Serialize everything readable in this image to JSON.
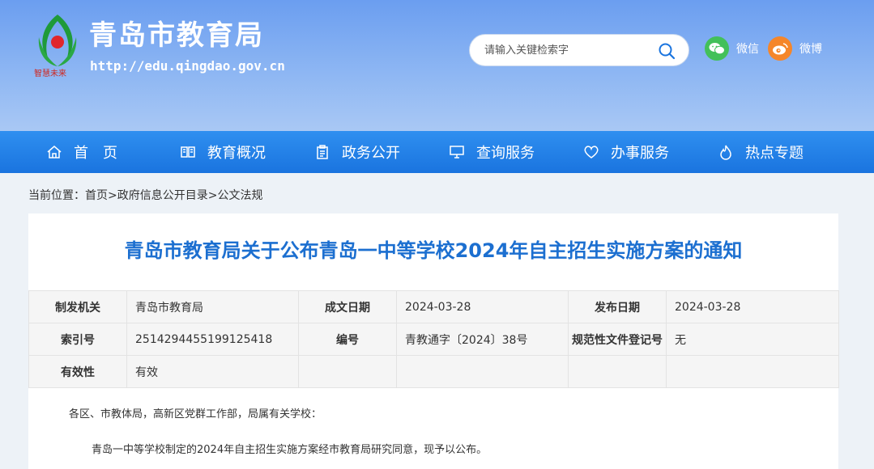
{
  "header": {
    "site_name": "青岛市教育局",
    "site_url": "http://edu.qingdao.gov.cn",
    "logo_icon": "green-red-emblem-icon",
    "search_placeholder": "请输入关键检索字",
    "social": [
      {
        "label": "微信",
        "icon": "wechat-icon",
        "color": "#43c05a"
      },
      {
        "label": "微博",
        "icon": "weibo-icon",
        "color": "#f5862a"
      }
    ]
  },
  "nav": {
    "items": [
      {
        "label": "首　页",
        "icon": "home-icon"
      },
      {
        "label": "教育概况",
        "icon": "book-icon"
      },
      {
        "label": "政务公开",
        "icon": "clipboard-icon"
      },
      {
        "label": "查询服务",
        "icon": "monitor-icon"
      },
      {
        "label": "办事服务",
        "icon": "heart-icon"
      },
      {
        "label": "热点专题",
        "icon": "flame-icon"
      }
    ]
  },
  "breadcrumb": {
    "prefix": "当前位置：",
    "items": [
      "首页",
      "政府信息公开目录",
      "公文法规"
    ],
    "separator": ">"
  },
  "article": {
    "title": "青岛市教育局关于公布青岛一中等学校2024年自主招生实施方案的通知",
    "meta": [
      [
        {
          "key": "制发机关",
          "value": "青岛市教育局"
        },
        {
          "key": "成文日期",
          "value": "2024-03-28"
        },
        {
          "key": "发布日期",
          "value": "2024-03-28"
        }
      ],
      [
        {
          "key": "索引号",
          "value": "2514294455199125418"
        },
        {
          "key": "编号",
          "value": "青教通字〔2024〕38号"
        },
        {
          "key": "规范性文件登记号",
          "value": "无"
        }
      ],
      [
        {
          "key": "有效性",
          "value": "有效"
        },
        {
          "key": "",
          "value": ""
        },
        {
          "key": "",
          "value": ""
        }
      ]
    ],
    "paragraphs": [
      "各区、市教体局，高新区党群工作部，局属有关学校：",
      "青岛一中等学校制定的2024年自主招生实施方案经市教育局研究同意，现予以公布。"
    ]
  },
  "colors": {
    "header_top": "#6b9ef0",
    "nav_bg": "#1a74df",
    "title": "#1c6fd0",
    "page_bg": "#edf2f7"
  }
}
